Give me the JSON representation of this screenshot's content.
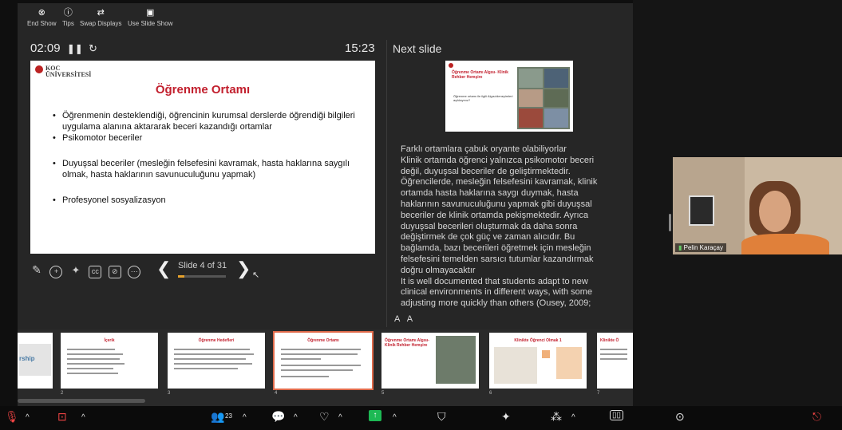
{
  "toolbar": {
    "end_show": "End Show",
    "tips": "Tips",
    "swap_displays": "Swap Displays",
    "use_slide_show": "Use Slide Show"
  },
  "presenter": {
    "timer": "02:09",
    "clock": "15:23",
    "next_slide_label": "Next slide",
    "slide_counter": "Slide 4 of 31",
    "progress_fraction": 0.13,
    "font_increase": "A",
    "font_decrease": "A"
  },
  "current_slide": {
    "logo_line1": "KOC",
    "logo_line2": "ÜNİVERSİTESİ",
    "title": "Öğrenme Ortamı",
    "bullets": [
      "Öğrenmenin desteklendiği, öğrencinin kurumsal derslerde öğrendiği bilgileri uygulama alanına aktararak beceri kazandığı ortamlar",
      "Psikomotor beceriler",
      "Duyuşsal beceriler (mesleğin felsefesini kavramak, hasta haklarına saygılı olmak, hasta haklarının savunuculuğunu yapmak)",
      "Profesyonel sosyalizasyon"
    ]
  },
  "next_slide": {
    "title": "Öğrenme Ortamı Algısı- Klinik Rehber Hemşire",
    "bullet": "Öğrenme ortamı ile ilgili Algısı/deneyimleri açıklayınız?"
  },
  "notes": "Farklı ortamlara çabuk oryante olabiliyorlar\nKlinik ortamda öğrenci yalnızca psikomotor beceri değil, duyuşsal beceriler de geliştirmektedir. Öğrencilerde, mesleğin felsefesini kavramak, klinik ortamda hasta haklarına saygı duymak, hasta haklarının savunuculuğunu yapmak gibi duyuşsal beceriler de klinik ortamda pekişmektedir. Ayrıca duyuşsal becerileri oluşturmak da daha sonra değiştirmek de çok güç ve zaman alıcıdır. Bu bağlamda, bazı becerileri öğretmek için mesleğin felsefesini temelden sarsıcı tutumlar kazandırmak doğru olmayacaktır\nIt is well documented that students adapt to new clinical environments in different ways, with some adjusting more quickly than others (Ousey, 2009;",
  "thumbnails": [
    {
      "num": "2",
      "title": "İçerik"
    },
    {
      "num": "3",
      "title": "Öğrenme Hedefleri"
    },
    {
      "num": "4",
      "title": "Öğrenme Ortamı"
    },
    {
      "num": "5",
      "title": "Öğrenme Ortamı Algısı- Klinik Rehber Hemşire"
    },
    {
      "num": "6",
      "title": "Klinikte Öğrenci Olmak 1"
    },
    {
      "num": "7",
      "title": "Klinikte Ö"
    }
  ],
  "participant": {
    "name": "Pelin Karaçay"
  },
  "bottom_bar": {
    "participants_count": "23"
  }
}
